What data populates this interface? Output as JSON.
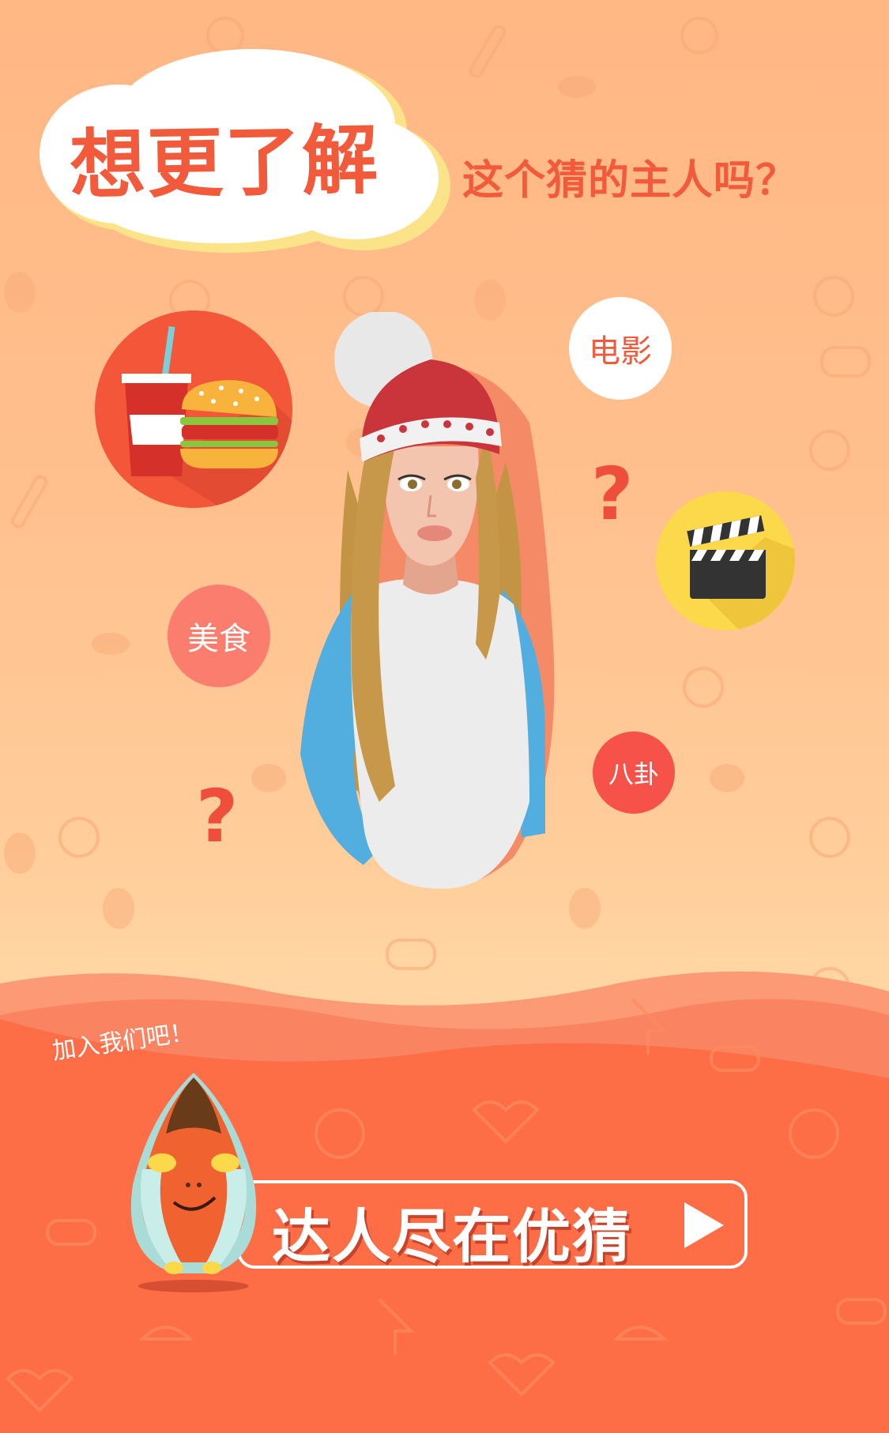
{
  "header": {
    "title": "想更了解",
    "subtitle": "这个猜的主人吗？"
  },
  "bubbles": {
    "movie": "电影",
    "food": "美食",
    "gossip": "八卦"
  },
  "question_mark": "?",
  "footer": {
    "join_text": "加入我们吧！",
    "cta_label": "达人尽在优猜"
  },
  "colors": {
    "accent": "#f15a3a",
    "top_background": "#ffbb86",
    "bottom_background": "#fd6f48",
    "yellow_bubble": "#fcd94a",
    "red_bubble": "#f96b4d"
  },
  "icons": [
    "fast-food-icon",
    "clapperboard-icon",
    "mascot-icon",
    "arrow-right-icon"
  ]
}
